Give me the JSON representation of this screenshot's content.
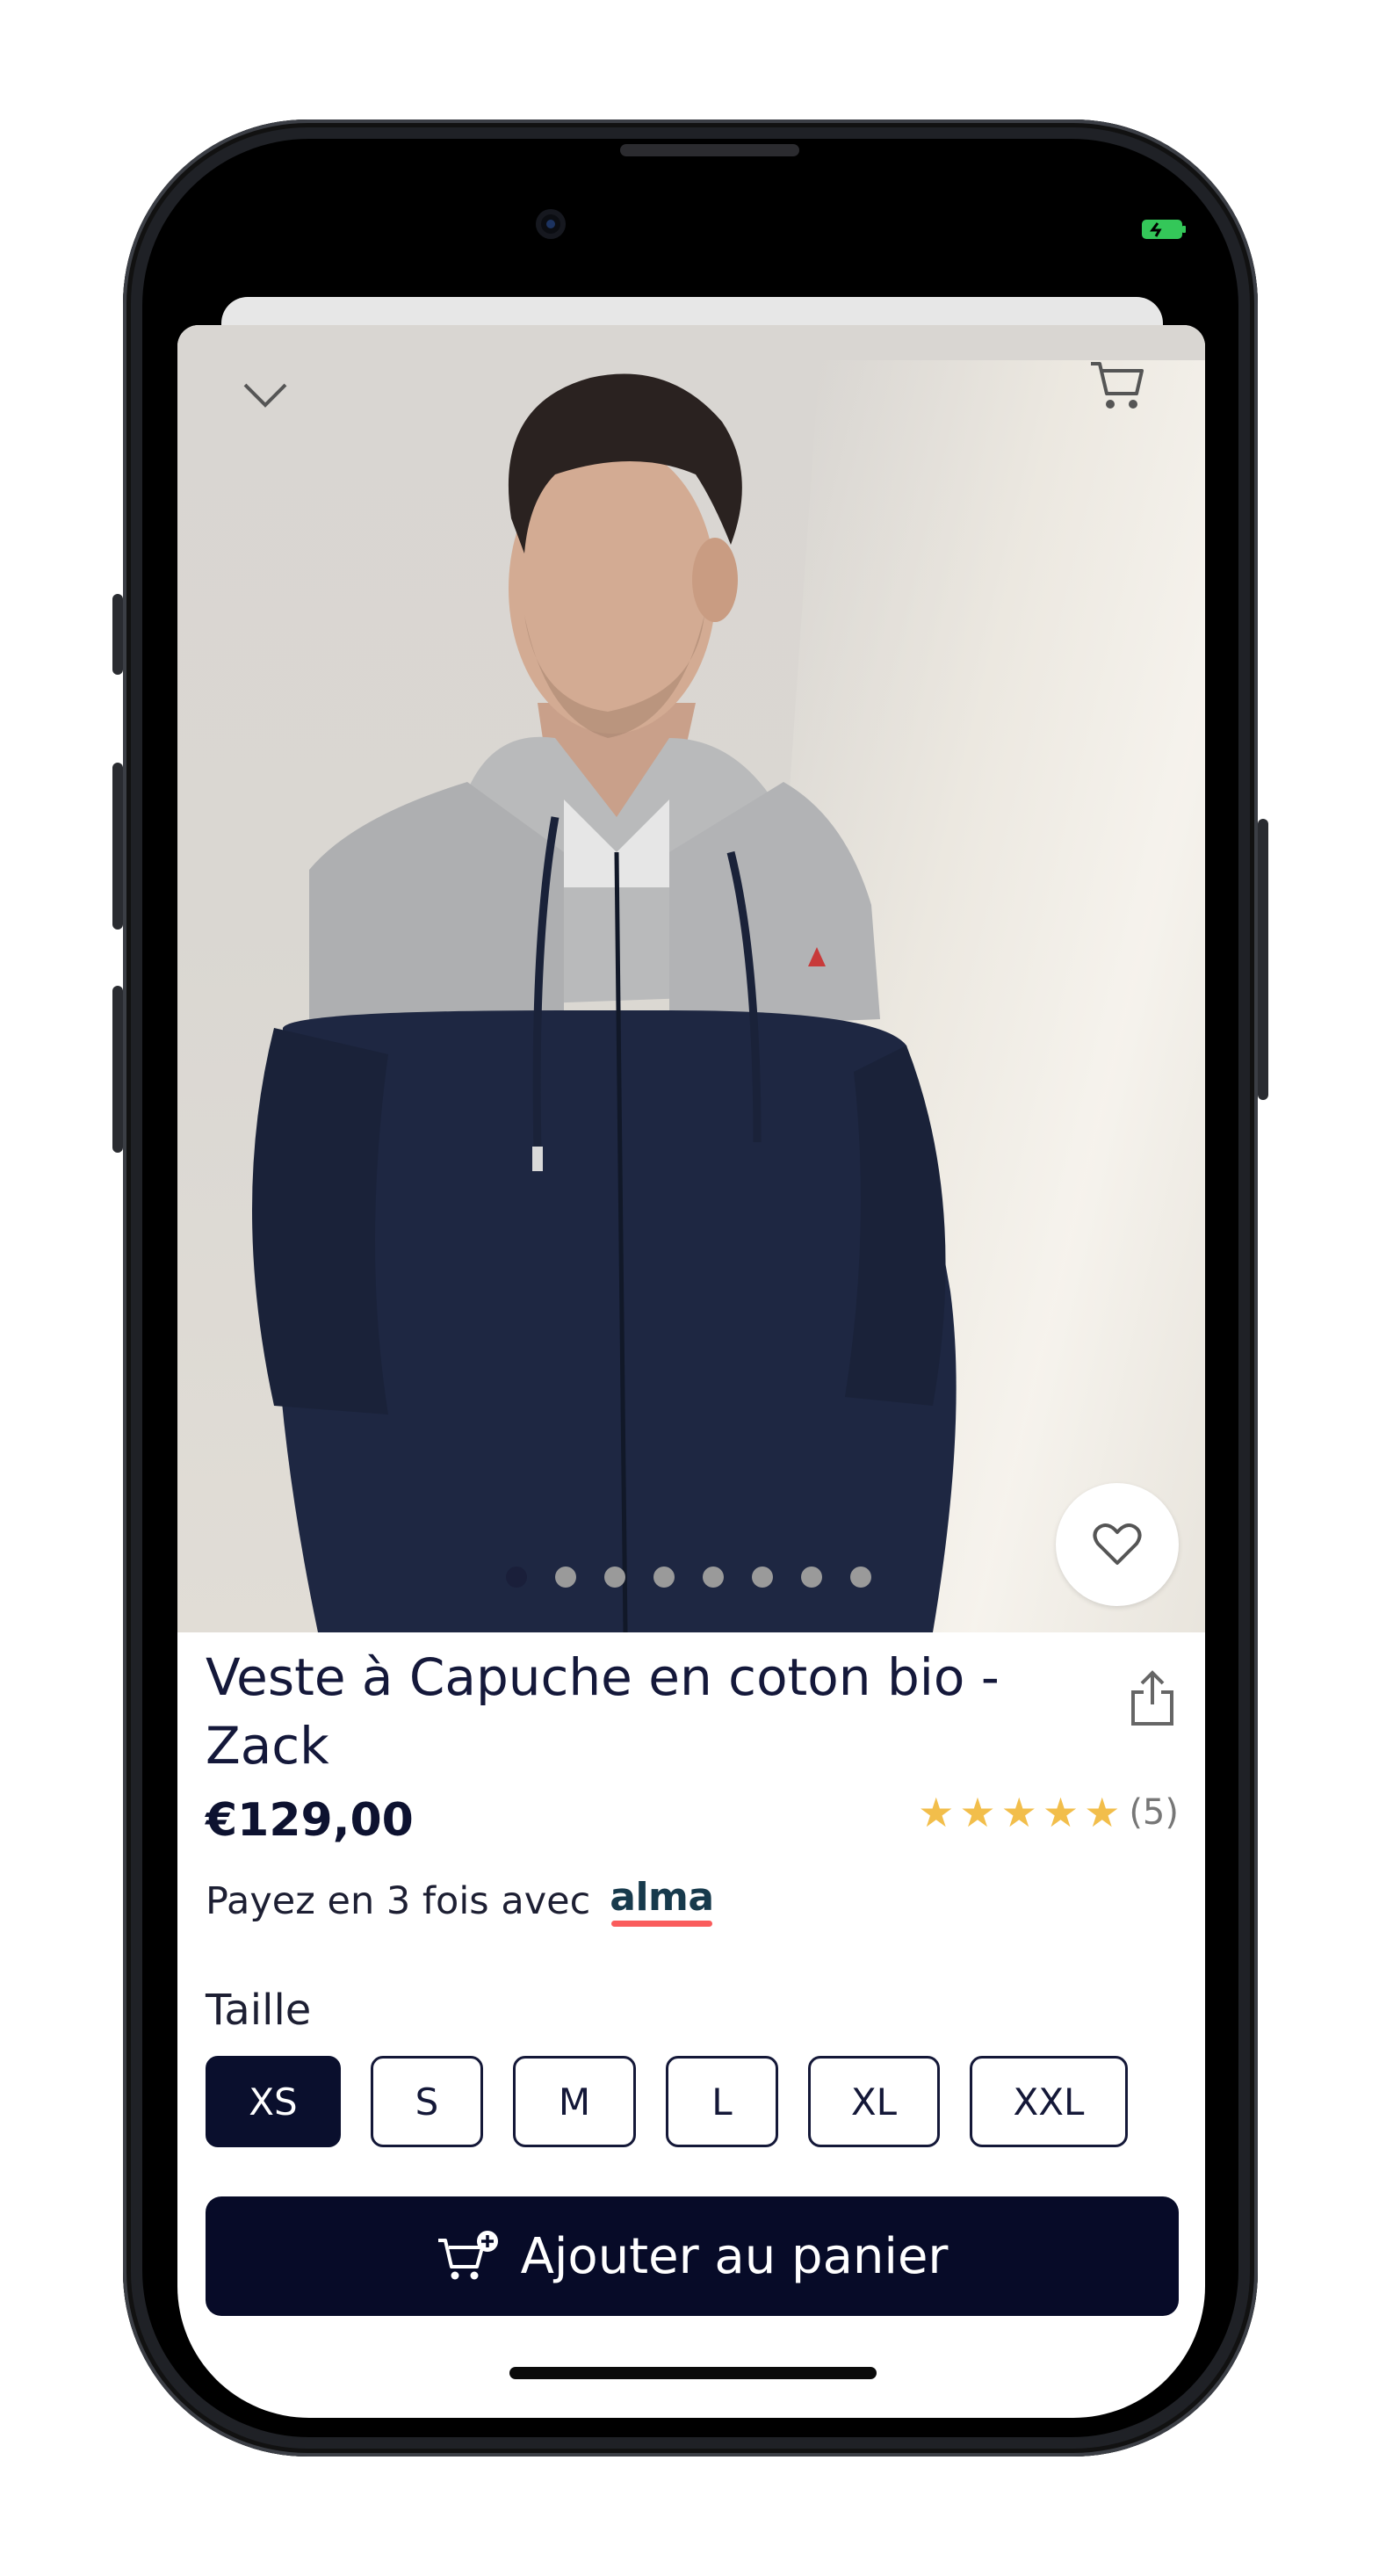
{
  "product": {
    "title": "Veste à Capuche en coton bio - Zack",
    "price": "€129,00",
    "rating": {
      "stars": 5,
      "count": "(5)"
    },
    "payment_text": "Payez en 3 fois avec",
    "payment_brand": "alma"
  },
  "gallery": {
    "image_count": 8,
    "active_index": 0
  },
  "size": {
    "label": "Taille",
    "options": [
      "XS",
      "S",
      "M",
      "L",
      "XL",
      "XXL"
    ],
    "selected": "XS"
  },
  "cta": {
    "label": "Ajouter au panier"
  },
  "icons": {
    "close": "chevron-down-icon",
    "cart": "cart-icon",
    "favorite": "heart-icon",
    "share": "share-icon",
    "add_to_cart": "cart-plus-icon"
  },
  "colors": {
    "primary": "#070b28",
    "star": "#f2be4b",
    "alma_accent": "#fa5c5c",
    "battery": "#34c759"
  }
}
